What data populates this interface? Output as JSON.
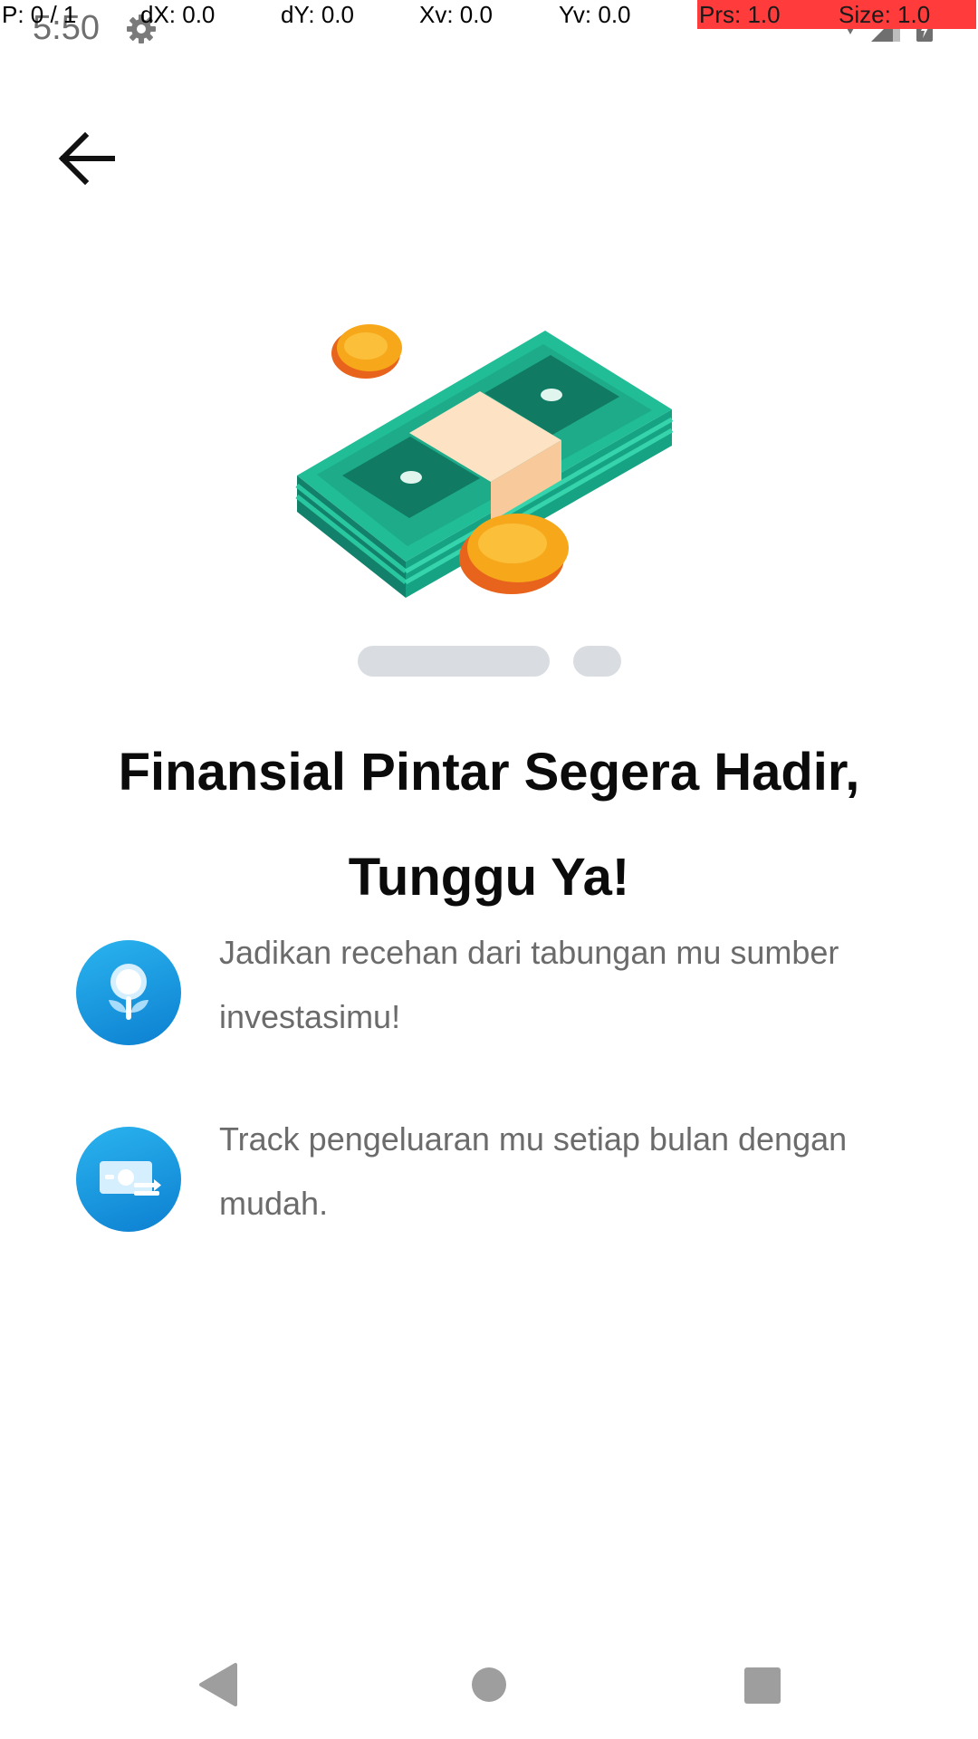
{
  "status_bar": {
    "time": "5:50",
    "settings_icon": "gear-icon",
    "right_icons": [
      "wifi-icon",
      "signal-icon",
      "battery-icon"
    ]
  },
  "debug_overlay": {
    "pointer": "P: 0 / 1",
    "dx": "dX: 0.0",
    "dy": "dY: 0.0",
    "xv": "Xv: 0.0",
    "yv": "Yv: 0.0",
    "prs": "Prs: 1.0",
    "size": "Size: 1.0"
  },
  "header": {
    "back_icon": "arrow-left-icon"
  },
  "illustration": {
    "icon": "money-stack-coins-icon",
    "colors": {
      "bill": "#1fb893",
      "bill_dark": "#12806a",
      "band": "#fde2c4",
      "coin": "#f7a81a",
      "coin_edge": "#e8641c"
    }
  },
  "pager": {
    "current_page": 1,
    "total_pages": 2
  },
  "main": {
    "title": "Finansial Pintar Segera Hadir, Tunggu Ya!",
    "features": [
      {
        "icon": "seed-investment-icon",
        "text": "Jadikan recehan dari tabungan mu sumber investasimu!"
      },
      {
        "icon": "money-transfer-icon",
        "text": "Track pengeluaran mu setiap bulan dengan mudah."
      }
    ]
  },
  "nav_bar": {
    "icons": [
      "nav-back-icon",
      "nav-home-icon",
      "nav-recents-icon"
    ]
  },
  "colors": {
    "title": "#0b0b0b",
    "body_text": "#6b6b6b",
    "accent_blue": "#1597e0",
    "pager": "#d9dde1",
    "debug_red": "#ff3b3b"
  }
}
